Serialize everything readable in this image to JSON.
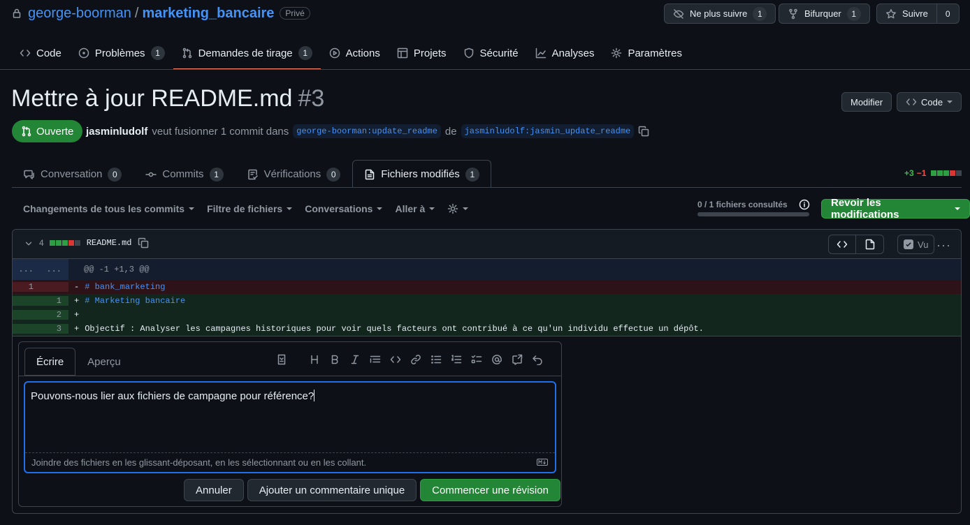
{
  "repo": {
    "owner": "george-boorman",
    "separator": "/",
    "name": "marketing_bancaire",
    "visibility": "Privé"
  },
  "header_actions": {
    "watch": {
      "label": "Ne plus suivre",
      "count": "1"
    },
    "fork": {
      "label": "Bifurquer",
      "count": "1"
    },
    "star": {
      "label": "Suivre",
      "count": "0"
    }
  },
  "nav": [
    {
      "label": "Code"
    },
    {
      "label": "Problèmes",
      "count": "1"
    },
    {
      "label": "Demandes de tirage",
      "count": "1"
    },
    {
      "label": "Actions"
    },
    {
      "label": "Projets"
    },
    {
      "label": "Sécurité"
    },
    {
      "label": "Analyses"
    },
    {
      "label": "Paramètres"
    }
  ],
  "pr": {
    "title": "Mettre à jour README.md",
    "number": "#3",
    "edit_label": "Modifier",
    "code_label": "Code",
    "state": "Ouverte",
    "author": "jasminludolf",
    "merge_text": "veut fusionner 1 commit dans",
    "base_branch": "george-boorman:update_readme",
    "from_word": "de",
    "head_branch": "jasminludolf:jasmin_update_readme"
  },
  "pr_tabs": [
    {
      "label": "Conversation",
      "count": "0"
    },
    {
      "label": "Commits",
      "count": "1"
    },
    {
      "label": "Vérifications",
      "count": "0"
    },
    {
      "label": "Fichiers modifiés",
      "count": "1"
    }
  ],
  "diffstat": {
    "additions": "+3",
    "deletions": "−1"
  },
  "toolbar": {
    "commits_filter": "Changements de tous les commits",
    "file_filter": "Filtre de fichiers",
    "conversations": "Conversations",
    "jump_to": "Aller à",
    "viewed_progress": "0 / 1 fichiers consultés",
    "viewed_fraction": 0,
    "review_button": "Revoir les modifications"
  },
  "file": {
    "changes": "4",
    "name": "README.md",
    "viewed_label": "Vu",
    "hunk": {
      "left": "...",
      "right": "...",
      "text": "@@ -1 +1,3 @@"
    },
    "lines": [
      {
        "type": "del",
        "old": "1",
        "new": "",
        "sign": "-",
        "text": "# bank_marketing"
      },
      {
        "type": "add",
        "old": "",
        "new": "1",
        "sign": "+",
        "text": "# Marketing bancaire"
      },
      {
        "type": "add",
        "old": "",
        "new": "2",
        "sign": "+",
        "text": ""
      },
      {
        "type": "add",
        "old": "",
        "new": "3",
        "sign": "+",
        "text": "Objectif : Analyser les campagnes historiques pour voir quels facteurs ont contribué à ce qu'un individu effectue un dépôt."
      }
    ]
  },
  "comment": {
    "tab_write": "Écrire",
    "tab_preview": "Aperçu",
    "body": "Pouvons-nous lier aux fichiers de campagne pour référence?",
    "attach_hint": "Joindre des fichiers en les glissant-déposant, en les sélectionnant ou en les collant.",
    "cancel": "Annuler",
    "single_comment": "Ajouter un commentaire unique",
    "start_review": "Commencer une révision"
  },
  "colors": {
    "accent_green": "#238636",
    "link_blue": "#4493f8",
    "active_tab_underline": "#f78166"
  }
}
